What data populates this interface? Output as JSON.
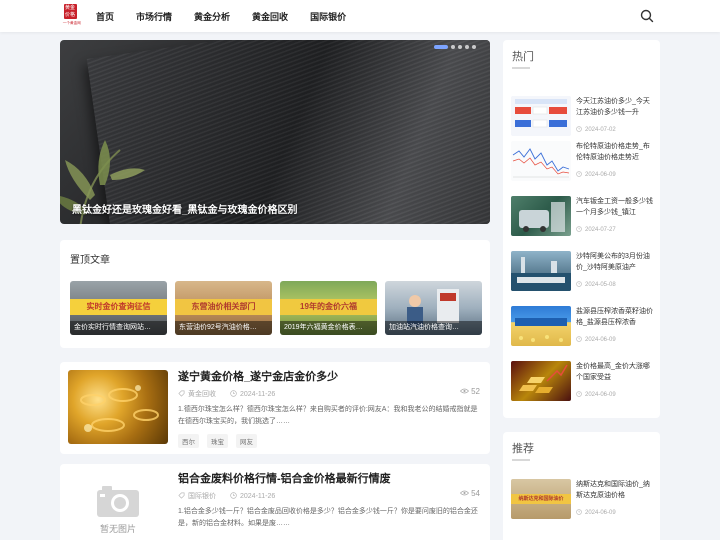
{
  "header": {
    "logo_text_top": "黄金",
    "logo_text_bottom": "价格",
    "logo_sub": "一个黄金网",
    "nav": [
      "首页",
      "市场行情",
      "黄金分析",
      "黄金回收",
      "国际银价"
    ]
  },
  "hero": {
    "caption": "黑钛金好还是玫瑰金好看_黑钛金与玫瑰金价格区别",
    "slides": 5,
    "active_slide": 1
  },
  "pinned": {
    "heading": "置顶文章",
    "items": [
      {
        "banner": "实时金价查询征信",
        "caption": "金价实时行情查询网站…",
        "banner_color": "#f5d03c"
      },
      {
        "banner": "东营油价相关部门",
        "caption": "东营油价92号汽油价格…",
        "banner_color": "#f1c542"
      },
      {
        "banner": "19年的金价六福",
        "caption": "2019年六福黄金价格表…",
        "banner_color": "#f0c93f"
      },
      {
        "banner": "",
        "caption": "加油站汽油价格查询…",
        "banner_color": ""
      }
    ]
  },
  "articles": [
    {
      "title": "遂宁黄金价格_遂宁金店金价多少",
      "category": "黄金回收",
      "date": "2024-11-26",
      "views": "52",
      "excerpt": "1.德西尔珠宝怎么样？德西尔珠宝怎么样？来自购买者的评价:网友A：我和我老公的结婚戒指就是在德西尔珠宝买的，我们挑选了……",
      "tags": [
        "西尔",
        "珠宝",
        "网友"
      ]
    },
    {
      "title": "铝合金废料价格行情-铝合金价格最新行情废",
      "category": "国际银价",
      "date": "2024-11-26",
      "views": "54",
      "excerpt": "1.铝合金多少钱一斤？铝合金废品回收价格是多少？铝合金多少钱一斤？你是要问废旧的铝合金还是，新的铝合金材料。如果是废……",
      "tags": [],
      "no_image_label": "暂无图片"
    }
  ],
  "sidebar_hot": {
    "heading": "热门",
    "items": [
      {
        "title": "今天江苏油价多少_今天江苏油价多少钱一升",
        "date": "2024-07-02"
      },
      {
        "title": "布伦特原油价格走势_布伦特原油价格走势近",
        "date": "2024-06-09"
      },
      {
        "title": "汽车钣金工资一般多少钱一个月多少钱_镇江",
        "date": "2024-07-27"
      },
      {
        "title": "沙特阿美公布的3月份油价_沙特阿美原油产",
        "date": "2024-05-08"
      },
      {
        "title": "盐源县压榨浓香菜籽油价格_盐源县压榨浓香",
        "date": "2024-06-09"
      },
      {
        "title": "金价格最高_金价大涨哪个国家受益",
        "date": "2024-06-09"
      }
    ]
  },
  "sidebar_rec": {
    "heading": "推荐",
    "items": [
      {
        "title": "纳斯达克和国际油价_纳斯达克原油价格",
        "date": "2024-06-09",
        "thumb_text": "纳斯达克和国际油价"
      }
    ]
  },
  "colors": {
    "accent": "#7da4ff",
    "logo_red": "#c8202a",
    "background": "#f2f4f8"
  }
}
